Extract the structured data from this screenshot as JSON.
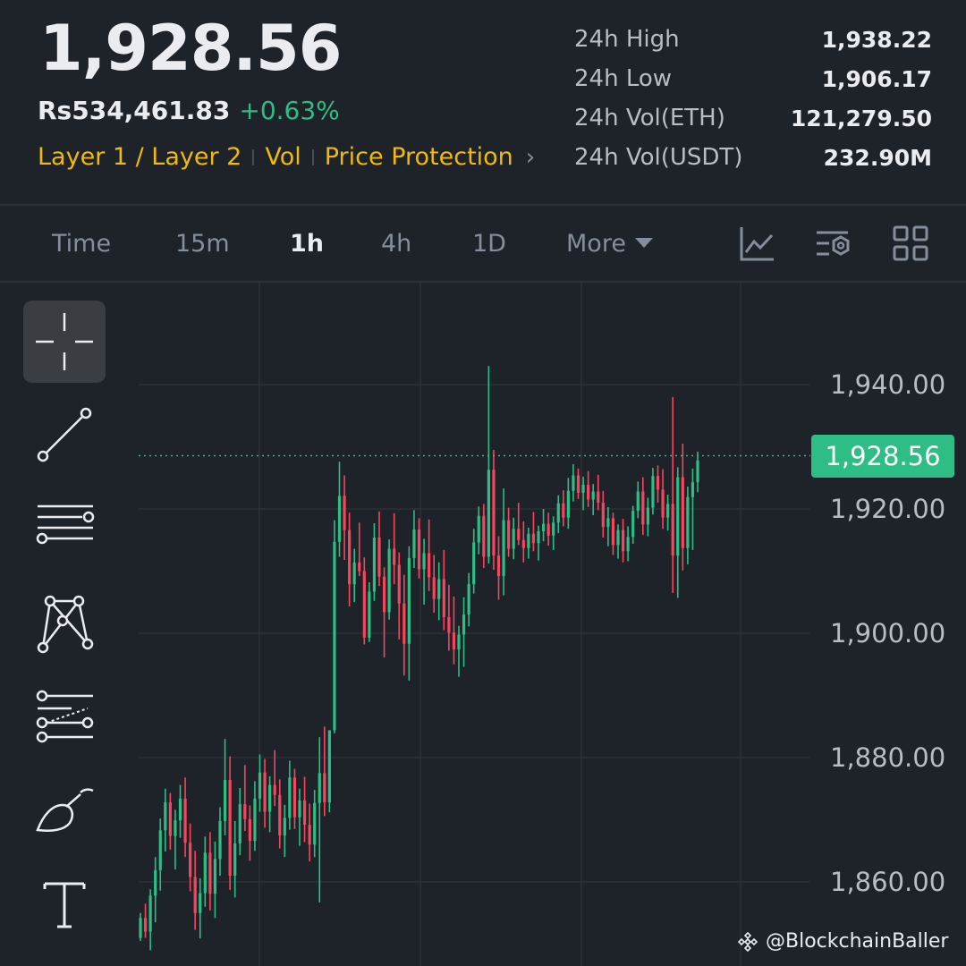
{
  "header": {
    "last_price": "1,928.56",
    "fiat_price": "Rs534,461.83",
    "change_pct": "+0.63%",
    "tags": [
      "Layer 1 / Layer 2",
      "Vol",
      "Price Protection"
    ],
    "chevron": "›"
  },
  "stats": [
    {
      "label": "24h High",
      "value": "1,938.22"
    },
    {
      "label": "24h Low",
      "value": "1,906.17"
    },
    {
      "label": "24h Vol(ETH)",
      "value": "121,279.50"
    },
    {
      "label": "24h Vol(USDT)",
      "value": "232.90M"
    }
  ],
  "timeframes": {
    "time": "Time",
    "m15": "15m",
    "h1": "1h",
    "h4": "4h",
    "d1": "1D",
    "more": "More",
    "active": "1h"
  },
  "toolbar_icons": [
    "indicator-chart-icon",
    "chart-settings-icon",
    "layout-grid-icon"
  ],
  "drawing_tools": [
    "crosshair-icon",
    "trend-line-icon",
    "horizontal-lines-icon",
    "pattern-icon",
    "fibonacci-icon",
    "brush-icon",
    "text-tool-icon"
  ],
  "colors": {
    "up": "#2ebd85",
    "down": "#f6465d",
    "accent": "#f0b90b",
    "background": "#1e2329"
  },
  "watermark": "@BlockchainBaller",
  "chart_data": {
    "type": "candlestick",
    "ylim": [
      1852,
      1952
    ],
    "y_ticks": [
      "1,940.00",
      "1,920.00",
      "1,900.00",
      "1,880.00",
      "1,860.00"
    ],
    "y_tick_values": [
      1940,
      1920,
      1900,
      1880,
      1860
    ],
    "last_price": 1928.56,
    "last_price_label": "1,928.56",
    "candles": [
      [
        1851.0,
        1855.0,
        1850.5,
        1854.2
      ],
      [
        1854.2,
        1856.5,
        1851.0,
        1852.0
      ],
      [
        1852.0,
        1858.8,
        1849.0,
        1857.8
      ],
      [
        1857.8,
        1864.0,
        1853.5,
        1861.9
      ],
      [
        1861.9,
        1870.2,
        1858.6,
        1868.3
      ],
      [
        1868.3,
        1875.0,
        1864.9,
        1872.8
      ],
      [
        1872.8,
        1874.3,
        1865.2,
        1867.4
      ],
      [
        1867.4,
        1871.6,
        1862.0,
        1869.9
      ],
      [
        1869.9,
        1875.6,
        1867.1,
        1873.4
      ],
      [
        1873.4,
        1876.8,
        1864.0,
        1866.3
      ],
      [
        1866.3,
        1869.4,
        1858.5,
        1860.8
      ],
      [
        1860.8,
        1865.0,
        1852.3,
        1855.0
      ],
      [
        1855.0,
        1860.6,
        1850.9,
        1858.2
      ],
      [
        1858.2,
        1867.3,
        1856.0,
        1864.7
      ],
      [
        1864.7,
        1868.0,
        1855.4,
        1858.1
      ],
      [
        1858.1,
        1866.5,
        1854.2,
        1863.7
      ],
      [
        1863.7,
        1872.0,
        1861.0,
        1869.8
      ],
      [
        1869.8,
        1883.0,
        1867.5,
        1876.4
      ],
      [
        1876.4,
        1880.2,
        1858.7,
        1861.0
      ],
      [
        1861.0,
        1869.8,
        1857.5,
        1866.2
      ],
      [
        1866.2,
        1875.1,
        1864.3,
        1872.5
      ],
      [
        1872.5,
        1878.8,
        1868.2,
        1870.1
      ],
      [
        1870.1,
        1872.3,
        1863.4,
        1866.6
      ],
      [
        1866.6,
        1876.2,
        1865.0,
        1873.4
      ],
      [
        1873.4,
        1880.5,
        1871.3,
        1877.6
      ],
      [
        1877.6,
        1879.8,
        1868.7,
        1871.3
      ],
      [
        1871.3,
        1877.0,
        1868.0,
        1875.6
      ],
      [
        1875.6,
        1881.2,
        1872.2,
        1874.0
      ],
      [
        1874.0,
        1876.5,
        1865.4,
        1867.5
      ],
      [
        1867.5,
        1872.4,
        1864.0,
        1870.3
      ],
      [
        1870.3,
        1879.5,
        1868.4,
        1876.8
      ],
      [
        1876.8,
        1878.2,
        1868.5,
        1870.4
      ],
      [
        1870.4,
        1875.0,
        1865.8,
        1873.1
      ],
      [
        1873.1,
        1876.9,
        1866.4,
        1869.2
      ],
      [
        1869.2,
        1872.6,
        1863.3,
        1866.0
      ],
      [
        1866.0,
        1874.8,
        1864.0,
        1872.7
      ],
      [
        1872.7,
        1883.3,
        1856.7,
        1877.5
      ],
      [
        1877.5,
        1885.0,
        1870.6,
        1872.8
      ],
      [
        1872.8,
        1882.6,
        1871.2,
        1884.4
      ],
      [
        1884.4,
        1918.2,
        1883.9,
        1914.7
      ],
      [
        1914.7,
        1927.6,
        1912.3,
        1922.1
      ],
      [
        1922.1,
        1925.4,
        1911.8,
        1916.6
      ],
      [
        1916.6,
        1919.4,
        1904.3,
        1907.9
      ],
      [
        1907.9,
        1913.6,
        1905.0,
        1911.4
      ],
      [
        1911.4,
        1917.8,
        1909.2,
        1910.0
      ],
      [
        1910.0,
        1912.2,
        1898.2,
        1899.3
      ],
      [
        1899.3,
        1908.2,
        1898.6,
        1906.7
      ],
      [
        1906.7,
        1917.7,
        1905.2,
        1915.4
      ],
      [
        1915.4,
        1919.6,
        1907.6,
        1909.1
      ],
      [
        1909.1,
        1910.6,
        1896.1,
        1903.4
      ],
      [
        1903.4,
        1915.1,
        1902.2,
        1913.6
      ],
      [
        1913.6,
        1919.3,
        1907.9,
        1911.0
      ],
      [
        1911.0,
        1913.0,
        1899.0,
        1904.8
      ],
      [
        1904.8,
        1909.4,
        1893.2,
        1898.3
      ],
      [
        1898.3,
        1914.0,
        1892.4,
        1912.1
      ],
      [
        1912.1,
        1919.8,
        1910.5,
        1916.7
      ],
      [
        1916.7,
        1918.5,
        1908.8,
        1910.3
      ],
      [
        1910.3,
        1915.2,
        1904.6,
        1912.9
      ],
      [
        1912.9,
        1918.3,
        1906.8,
        1909.0
      ],
      [
        1909.0,
        1912.6,
        1903.3,
        1905.5
      ],
      [
        1905.5,
        1911.4,
        1902.1,
        1908.7
      ],
      [
        1908.7,
        1913.4,
        1900.5,
        1902.6
      ],
      [
        1902.6,
        1907.8,
        1897.2,
        1900.1
      ],
      [
        1900.1,
        1905.9,
        1895.0,
        1897.4
      ],
      [
        1897.4,
        1901.2,
        1893.0,
        1899.8
      ],
      [
        1899.8,
        1905.8,
        1894.6,
        1903.0
      ],
      [
        1903.0,
        1909.7,
        1901.1,
        1907.9
      ],
      [
        1907.9,
        1916.8,
        1906.4,
        1914.6
      ],
      [
        1914.6,
        1920.4,
        1912.7,
        1918.9
      ],
      [
        1918.9,
        1920.8,
        1910.5,
        1912.3
      ],
      [
        1912.3,
        1943.0,
        1911.2,
        1926.3
      ],
      [
        1926.3,
        1929.5,
        1910.2,
        1912.5
      ],
      [
        1912.5,
        1915.6,
        1905.4,
        1909.2
      ],
      [
        1909.2,
        1923.3,
        1906.1,
        1918.2
      ],
      [
        1918.2,
        1920.2,
        1912.3,
        1913.6
      ],
      [
        1913.6,
        1918.6,
        1911.9,
        1916.8
      ],
      [
        1916.8,
        1921.0,
        1914.2,
        1915.0
      ],
      [
        1915.0,
        1918.0,
        1911.4,
        1913.7
      ],
      [
        1913.7,
        1917.0,
        1912.0,
        1916.0
      ],
      [
        1916.0,
        1919.5,
        1913.2,
        1914.5
      ],
      [
        1914.5,
        1917.3,
        1911.7,
        1916.4
      ],
      [
        1916.4,
        1920.0,
        1914.8,
        1917.6
      ],
      [
        1917.6,
        1919.4,
        1914.1,
        1915.7
      ],
      [
        1915.7,
        1918.8,
        1913.4,
        1917.8
      ],
      [
        1917.8,
        1922.2,
        1916.1,
        1920.9
      ],
      [
        1920.9,
        1923.0,
        1917.2,
        1918.6
      ],
      [
        1918.6,
        1925.0,
        1916.8,
        1922.9
      ],
      [
        1922.9,
        1927.2,
        1921.2,
        1925.4
      ],
      [
        1925.4,
        1926.5,
        1921.6,
        1922.6
      ],
      [
        1922.6,
        1925.2,
        1919.8,
        1923.9
      ],
      [
        1923.9,
        1926.1,
        1920.3,
        1921.5
      ],
      [
        1921.5,
        1924.0,
        1919.0,
        1922.8
      ],
      [
        1922.8,
        1925.5,
        1919.8,
        1921.0
      ],
      [
        1921.0,
        1922.9,
        1915.4,
        1917.1
      ],
      [
        1917.1,
        1920.3,
        1914.0,
        1918.5
      ],
      [
        1918.5,
        1919.4,
        1912.6,
        1914.2
      ],
      [
        1914.2,
        1917.5,
        1912.0,
        1916.6
      ],
      [
        1916.6,
        1918.4,
        1911.4,
        1913.2
      ],
      [
        1913.2,
        1917.2,
        1911.6,
        1915.5
      ],
      [
        1915.5,
        1920.5,
        1914.4,
        1919.7
      ],
      [
        1919.7,
        1924.4,
        1918.5,
        1922.8
      ],
      [
        1922.8,
        1925.1,
        1915.8,
        1917.5
      ],
      [
        1917.5,
        1921.8,
        1915.6,
        1920.2
      ],
      [
        1920.2,
        1926.6,
        1919.1,
        1925.3
      ],
      [
        1925.3,
        1927.0,
        1921.0,
        1923.1
      ],
      [
        1923.1,
        1926.4,
        1916.8,
        1918.6
      ],
      [
        1918.6,
        1922.3,
        1916.5,
        1920.8
      ],
      [
        1920.8,
        1938.0,
        1906.5,
        1912.5
      ],
      [
        1912.5,
        1926.7,
        1905.7,
        1925.1
      ],
      [
        1925.1,
        1930.5,
        1910.1,
        1913.7
      ],
      [
        1913.7,
        1923.6,
        1911.1,
        1921.9
      ],
      [
        1921.9,
        1926.5,
        1913.4,
        1924.3
      ],
      [
        1924.3,
        1929.2,
        1922.7,
        1927.8
      ]
    ]
  }
}
